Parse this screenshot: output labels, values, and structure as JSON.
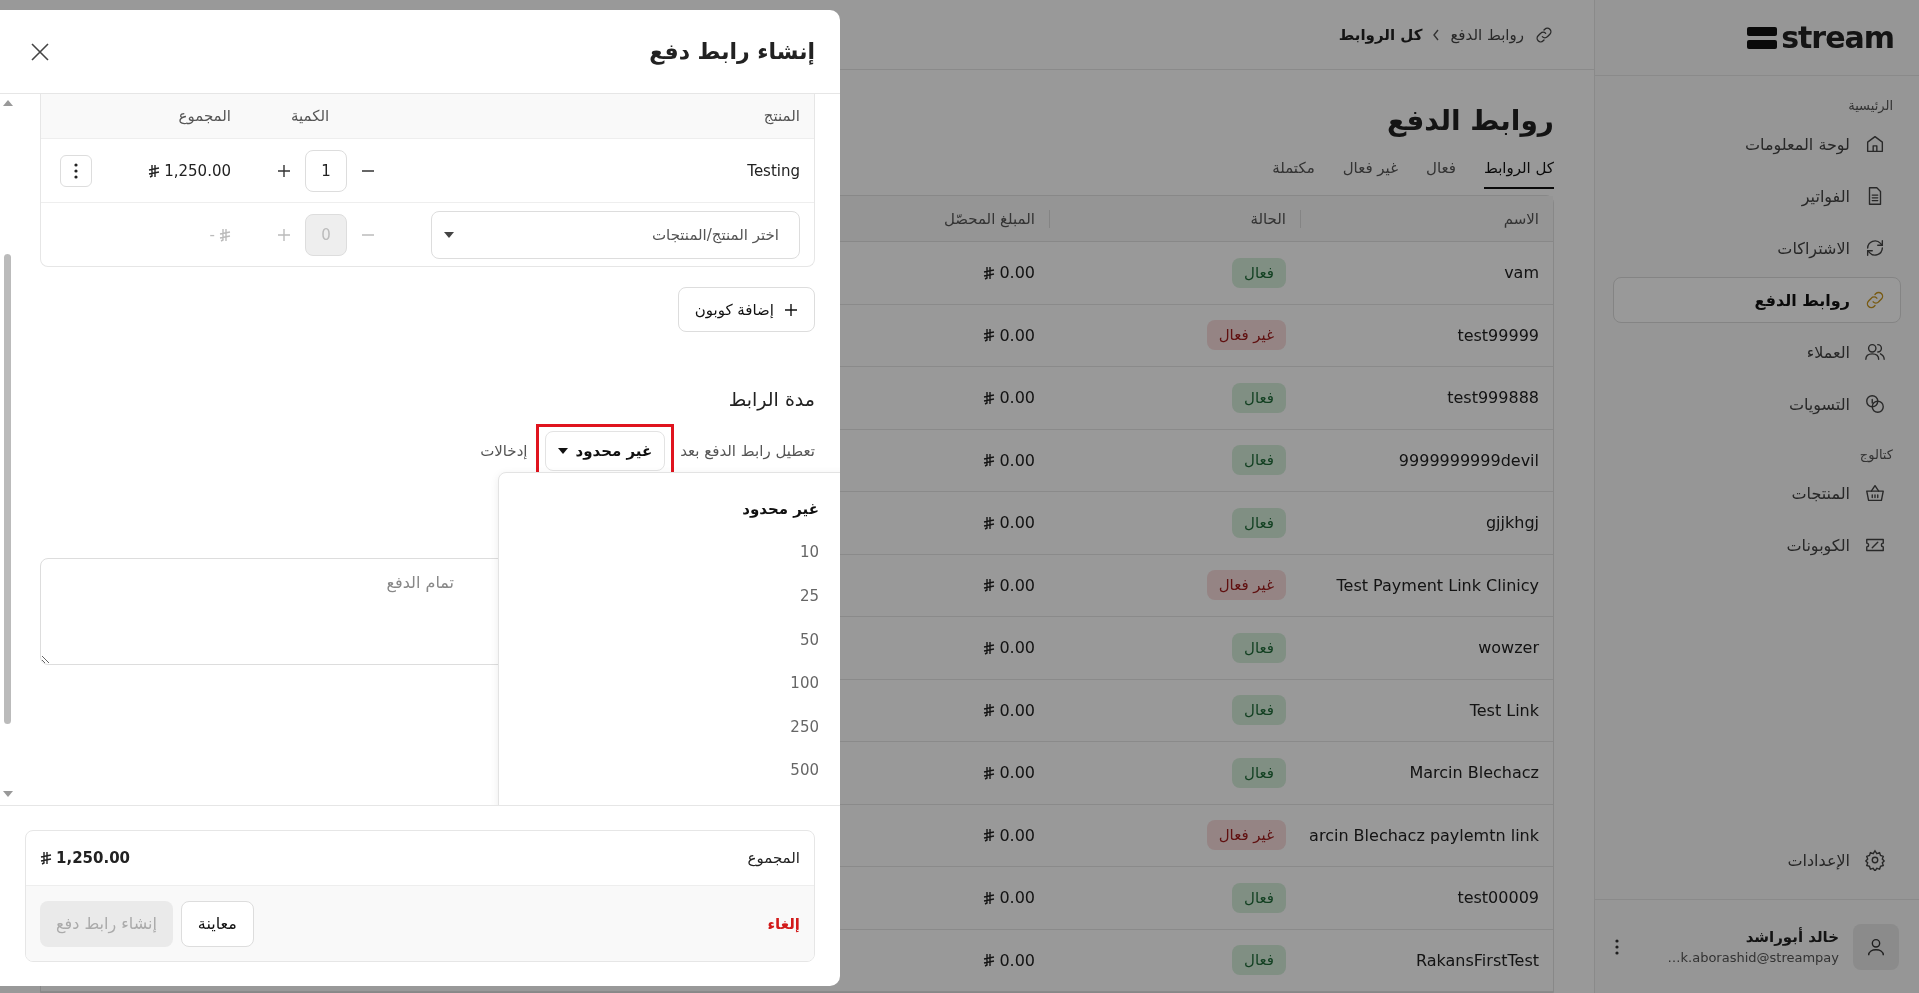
{
  "sidebar": {
    "logo": "stream",
    "sections": [
      {
        "title": "الرئيسية",
        "items": [
          {
            "label": "لوحة المعلومات",
            "selected": false
          },
          {
            "label": "الفواتير",
            "selected": false
          },
          {
            "label": "الاشتراكات",
            "selected": false
          },
          {
            "label": "روابط الدفع",
            "selected": true
          },
          {
            "label": "العملاء",
            "selected": false
          },
          {
            "label": "التسويات",
            "selected": false
          }
        ]
      },
      {
        "title": "كتالوج",
        "items": [
          {
            "label": "المنتجات",
            "selected": false
          },
          {
            "label": "الكوبونات",
            "selected": false
          }
        ]
      }
    ],
    "settings": {
      "label": "الإعدادات"
    },
    "user": {
      "name": "خالد أبوراشد",
      "email": "k.aborashid@streampay…"
    }
  },
  "breadcrumb": {
    "parent": "روابط الدفع",
    "current": "كل الروابط"
  },
  "page_title": "روابط الدفع",
  "tabs": [
    {
      "label": "كل الروابط",
      "selected": true
    },
    {
      "label": "فعال",
      "selected": false
    },
    {
      "label": "غير فعال",
      "selected": false
    },
    {
      "label": "مكتملة",
      "selected": false
    }
  ],
  "table": {
    "columns": [
      "الاسم",
      "الحالة",
      "المبلغ المحصّل"
    ],
    "rows": [
      {
        "name": "vam",
        "status": {
          "kind": "active",
          "label": "فعال"
        },
        "amount": "0.00"
      },
      {
        "name": "test99999",
        "status": {
          "kind": "inactive",
          "label": "غير فعال"
        },
        "amount": "0.00"
      },
      {
        "name": "test999888",
        "status": {
          "kind": "active",
          "label": "فعال"
        },
        "amount": "0.00"
      },
      {
        "name": "9999999999devil",
        "status": {
          "kind": "active",
          "label": "فعال"
        },
        "amount": "0.00"
      },
      {
        "name": "gjjkhgj",
        "status": {
          "kind": "active",
          "label": "فعال"
        },
        "amount": "0.00"
      },
      {
        "name": "Test Payment Link Clinicy",
        "status": {
          "kind": "inactive",
          "label": "غير فعال"
        },
        "amount": "0.00"
      },
      {
        "name": "wowzer",
        "status": {
          "kind": "active",
          "label": "فعال"
        },
        "amount": "0.00"
      },
      {
        "name": "Test Link",
        "status": {
          "kind": "active",
          "label": "فعال"
        },
        "amount": "0.00"
      },
      {
        "name": "Marcin Blechacz",
        "status": {
          "kind": "active",
          "label": "فعال"
        },
        "amount": "0.00"
      },
      {
        "name": "arcin Blechacz paylemtn link",
        "status": {
          "kind": "inactive",
          "label": "غير فعال"
        },
        "amount": "0.00"
      },
      {
        "name": "test00009",
        "status": {
          "kind": "active",
          "label": "فعال"
        },
        "amount": "0.00"
      },
      {
        "name": "RakansFirstTest",
        "status": {
          "kind": "active",
          "label": "فعال"
        },
        "amount": "0.00"
      }
    ]
  },
  "modal": {
    "title": "إنشاء رابط دفع",
    "products": {
      "columns": [
        "المنتج",
        "الكمية",
        "المجموع"
      ],
      "rows": [
        {
          "kind": "item",
          "product": "Testing",
          "quantity": "1",
          "total": "1,250.00"
        },
        {
          "kind": "picker",
          "placeholder": "اختر المنتج/المنتجات",
          "quantity": "0",
          "total": "-"
        }
      ]
    },
    "add_coupon": "إضافة كوبون",
    "duration": {
      "title": "مدة الرابط",
      "prefix": "تعطيل رابط الدفع بعد",
      "value": "غير محدود",
      "suffix": "إدخالات",
      "options": [
        {
          "label": "غير محدود",
          "selected": true
        },
        {
          "label": "10",
          "selected": false
        },
        {
          "label": "25",
          "selected": false
        },
        {
          "label": "50",
          "selected": false
        },
        {
          "label": "100",
          "selected": false
        },
        {
          "label": "250",
          "selected": false
        },
        {
          "label": "500",
          "selected": false
        }
      ]
    },
    "note": {
      "placeholder": "تمام الدفع"
    },
    "summary": {
      "label": "المجموع",
      "total": "1,250.00"
    },
    "actions": {
      "cancel": "إلغاء",
      "preview": "معاينة",
      "create": {
        "label": "إنشاء رابط دفع",
        "disabled": true
      }
    }
  }
}
